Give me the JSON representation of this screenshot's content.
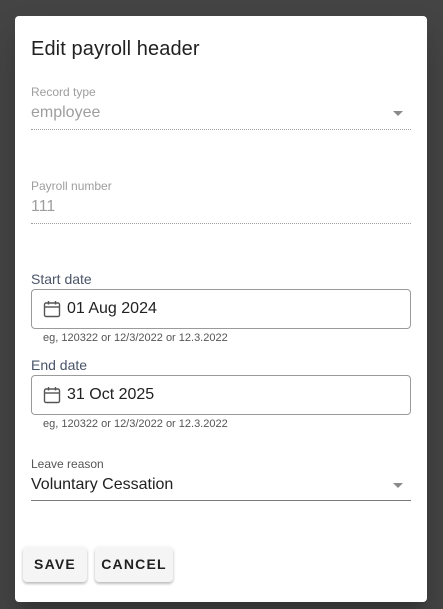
{
  "dialog": {
    "title": "Edit payroll header"
  },
  "record_type": {
    "label": "Record type",
    "value": "employee"
  },
  "payroll_number": {
    "label": "Payroll number",
    "value": "111"
  },
  "start_date": {
    "label": "Start date",
    "value": "01 Aug 2024",
    "helper": "eg, 120322 or 12/3/2022 or 12.3.2022"
  },
  "end_date": {
    "label": "End date",
    "value": "31 Oct 2025",
    "helper": "eg, 120322 or 12/3/2022 or 12.3.2022"
  },
  "leave_reason": {
    "label": "Leave reason",
    "value": "Voluntary Cessation"
  },
  "actions": {
    "save_label": "SAVE",
    "cancel_label": "CANCEL"
  },
  "icons": {
    "date": "calendar-icon",
    "dropdown": "chevron-down-icon"
  },
  "colors": {
    "backdrop": "#444444",
    "surface": "#ffffff",
    "text_primary": "#212121",
    "text_disabled": "#9e9e9e",
    "button_bg": "#f5f5f5"
  }
}
